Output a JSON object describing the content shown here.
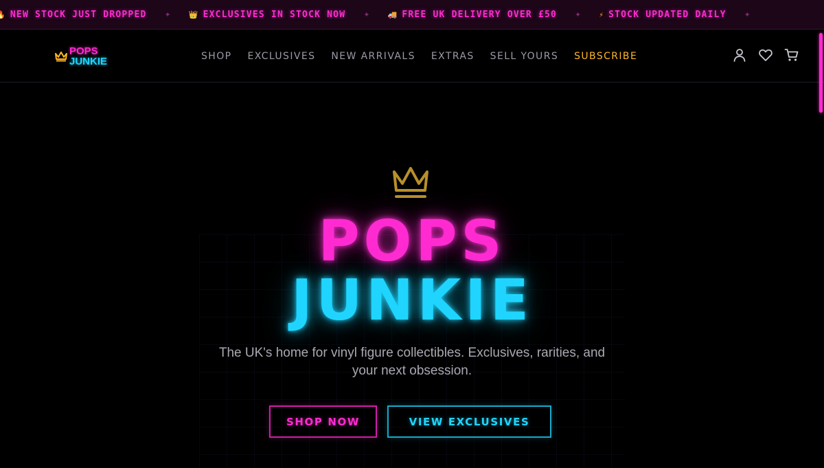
{
  "colors": {
    "neon_pink": "#ff2bd1",
    "neon_cyan": "#1fd5ff",
    "gold": "#ffb627",
    "nav_gray": "#9b9ba6",
    "tagline_gray": "#a9a9b3"
  },
  "ticker": {
    "items": [
      {
        "emoji": "🔥",
        "icon": "fire-icon",
        "text": "NEW STOCK JUST DROPPED"
      },
      {
        "emoji": "👑",
        "icon": "crown-icon",
        "text": "EXCLUSIVES IN STOCK NOW"
      },
      {
        "emoji": "🚚",
        "icon": "delivery-truck-icon",
        "text": "FREE UK DELIVERY OVER £50"
      },
      {
        "emoji": "⚡",
        "icon": "lightning-icon",
        "text": "STOCK UPDATED DAILY"
      }
    ],
    "separator": "✦"
  },
  "header": {
    "logo": {
      "line1": "POPS",
      "line2": "JUNKIE",
      "icon": "crown-icon"
    },
    "nav": [
      {
        "label": "SHOP"
      },
      {
        "label": "EXCLUSIVES"
      },
      {
        "label": "NEW ARRIVALS"
      },
      {
        "label": "EXTRAS"
      },
      {
        "label": "SELL YOURS"
      },
      {
        "label": "SUBSCRIBE"
      }
    ],
    "icons": [
      "account-icon",
      "wishlist-heart-icon",
      "cart-icon"
    ]
  },
  "hero": {
    "crown_icon": "crown-icon",
    "title_line1": "POPS",
    "title_line2": "JUNKIE",
    "tagline": "The UK's home for vinyl figure collectibles. Exclusives, rarities, and your next obsession.",
    "buttons": {
      "primary": "SHOP NOW",
      "secondary": "VIEW EXCLUSIVES"
    }
  }
}
